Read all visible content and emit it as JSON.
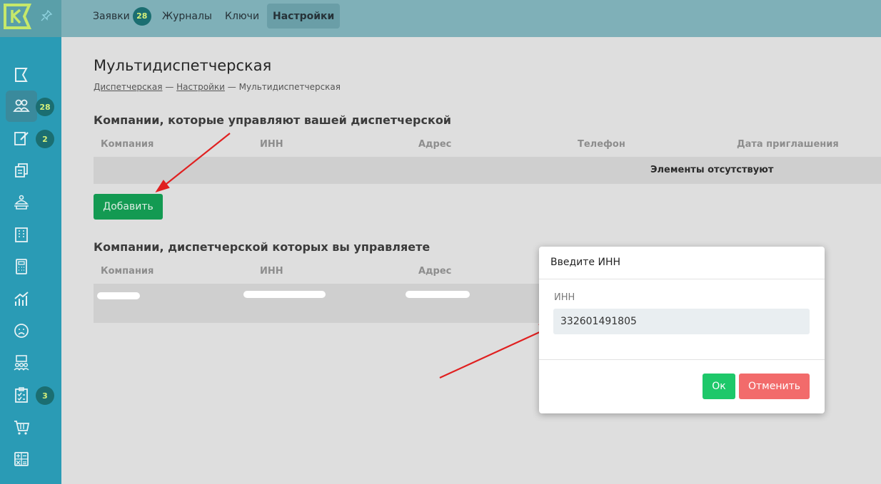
{
  "colors": {
    "sidebar": "#2a9bb5",
    "accent_green": "#139a52",
    "ok_green": "#1ec86a",
    "cancel_red": "#f26b6b",
    "badge_bg": "#1b6e71",
    "badge_text": "#d6f07a",
    "arrow_red": "#e02020"
  },
  "topbar": {
    "tabs": [
      {
        "label": "Заявки",
        "badge": "28"
      },
      {
        "label": "Журналы"
      },
      {
        "label": "Ключи"
      },
      {
        "label": "Настройки",
        "active": true
      }
    ]
  },
  "sidebar": {
    "items": [
      {
        "icon": "flag-icon"
      },
      {
        "icon": "users-icon",
        "badge": "28",
        "active": true
      },
      {
        "icon": "edit-document-icon",
        "badge": "2"
      },
      {
        "icon": "documents-icon"
      },
      {
        "icon": "concierge-icon"
      },
      {
        "icon": "building-icon"
      },
      {
        "icon": "calculator-icon"
      },
      {
        "icon": "chart-icon"
      },
      {
        "icon": "sad-face-icon"
      },
      {
        "icon": "team-icon"
      },
      {
        "icon": "checklist-icon",
        "badge": "3"
      },
      {
        "icon": "cart-icon"
      },
      {
        "icon": "math-ops-icon"
      }
    ]
  },
  "page": {
    "title": "Мультидиспетчерская",
    "breadcrumb": [
      "Диспетчерская",
      "Настройки",
      "Мультидиспетчерская"
    ],
    "breadcrumb_sep": "—"
  },
  "section1": {
    "title": "Компании, которые управляют вашей диспетчерской",
    "columns": [
      "Компания",
      "ИНН",
      "Адрес",
      "Телефон",
      "Дата приглашения"
    ],
    "empty_text": "Элементы отсутствуют",
    "add_button": "Добавить"
  },
  "section2": {
    "title": "Компании, диспетчерской которых вы управляете",
    "columns": [
      "Компания",
      "ИНН",
      "Адрес"
    ]
  },
  "modal": {
    "title": "Введите ИНН",
    "field_label": "ИНН",
    "field_value": "332601491805",
    "ok_label": "Ок",
    "cancel_label": "Отменить"
  }
}
